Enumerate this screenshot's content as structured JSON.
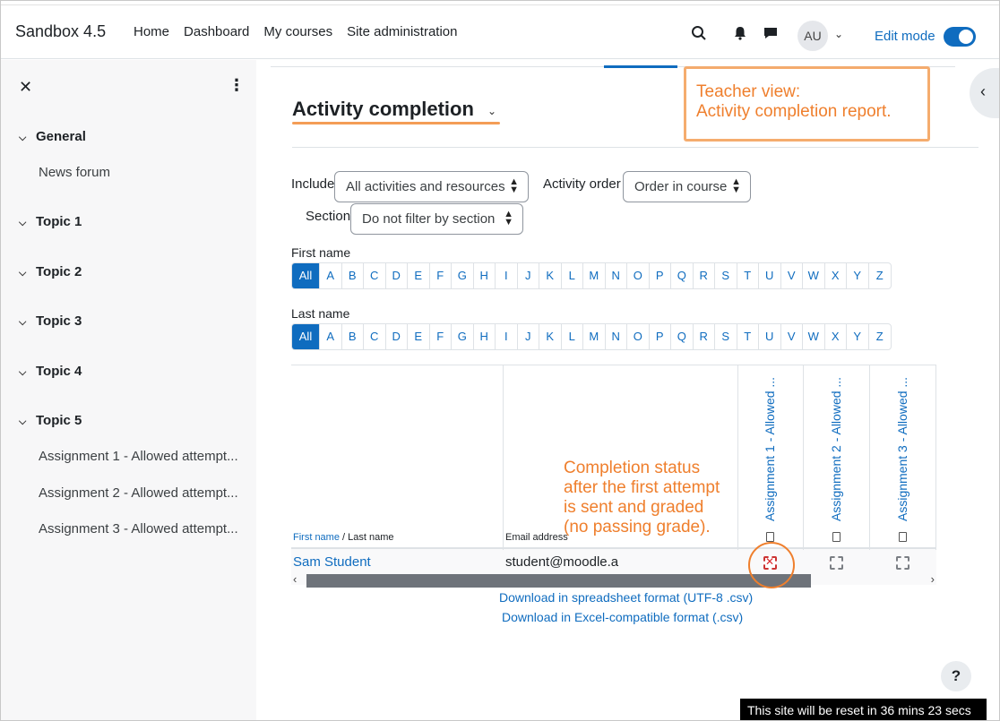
{
  "navbar": {
    "brand": "Sandbox 4.5",
    "links": [
      "Home",
      "Dashboard",
      "My courses",
      "Site administration"
    ],
    "avatar_initials": "AU",
    "edit_mode_label": "Edit mode",
    "edit_mode_on": true,
    "icons": [
      "search-icon",
      "bell-icon",
      "messages-icon"
    ]
  },
  "sidebar": {
    "sections": [
      {
        "label": "General",
        "items": [
          "News forum"
        ]
      },
      {
        "label": "Topic 1",
        "items": []
      },
      {
        "label": "Topic 2",
        "items": []
      },
      {
        "label": "Topic 3",
        "items": []
      },
      {
        "label": "Topic 4",
        "items": []
      },
      {
        "label": "Topic 5",
        "items": [
          "Assignment 1 - Allowed attempt...",
          "Assignment 2 - Allowed attempt...",
          "Assignment 3 - Allowed attempt..."
        ]
      }
    ]
  },
  "main": {
    "title": "Activity completion",
    "filters": {
      "include_label": "Include",
      "include_value": "All activities and resources",
      "order_label": "Activity order",
      "order_value": "Order in course",
      "section_label": "Section",
      "section_value": "Do not filter by section"
    },
    "first_name_label": "First name",
    "last_name_label": "Last name",
    "letters": [
      "All",
      "A",
      "B",
      "C",
      "D",
      "E",
      "F",
      "G",
      "H",
      "I",
      "J",
      "K",
      "L",
      "M",
      "N",
      "O",
      "P",
      "Q",
      "R",
      "S",
      "T",
      "U",
      "V",
      "W",
      "X",
      "Y",
      "Z"
    ],
    "table": {
      "col_firstname": "First name",
      "col_sep": " / ",
      "col_lastname": "Last name",
      "col_email": "Email address",
      "activities": [
        "Assignment 1 - Allowed ...",
        "Assignment 2 - Allowed ...",
        "Assignment 3 - Allowed ..."
      ],
      "rows": [
        {
          "name": "Sam Student",
          "email": "student@moodle.a",
          "status": [
            "fail",
            "incomplete",
            "incomplete"
          ]
        }
      ]
    },
    "downloads": [
      "Download in spreadsheet format (UTF-8 .csv)",
      "Download in Excel-compatible format (.csv)"
    ]
  },
  "annotations": {
    "teacher_note_line1": "Teacher view:",
    "teacher_note_line2": "Activity completion report.",
    "status_note_lines": [
      "Completion status",
      "after the first attempt",
      "is sent and graded",
      "(no passing grade)."
    ]
  },
  "footer": {
    "help_label": "?",
    "reset_text": "This site will be reset in 36 mins 23 secs"
  },
  "colors": {
    "primary": "#0f6cbf",
    "annotation": "#ef7f2d"
  }
}
